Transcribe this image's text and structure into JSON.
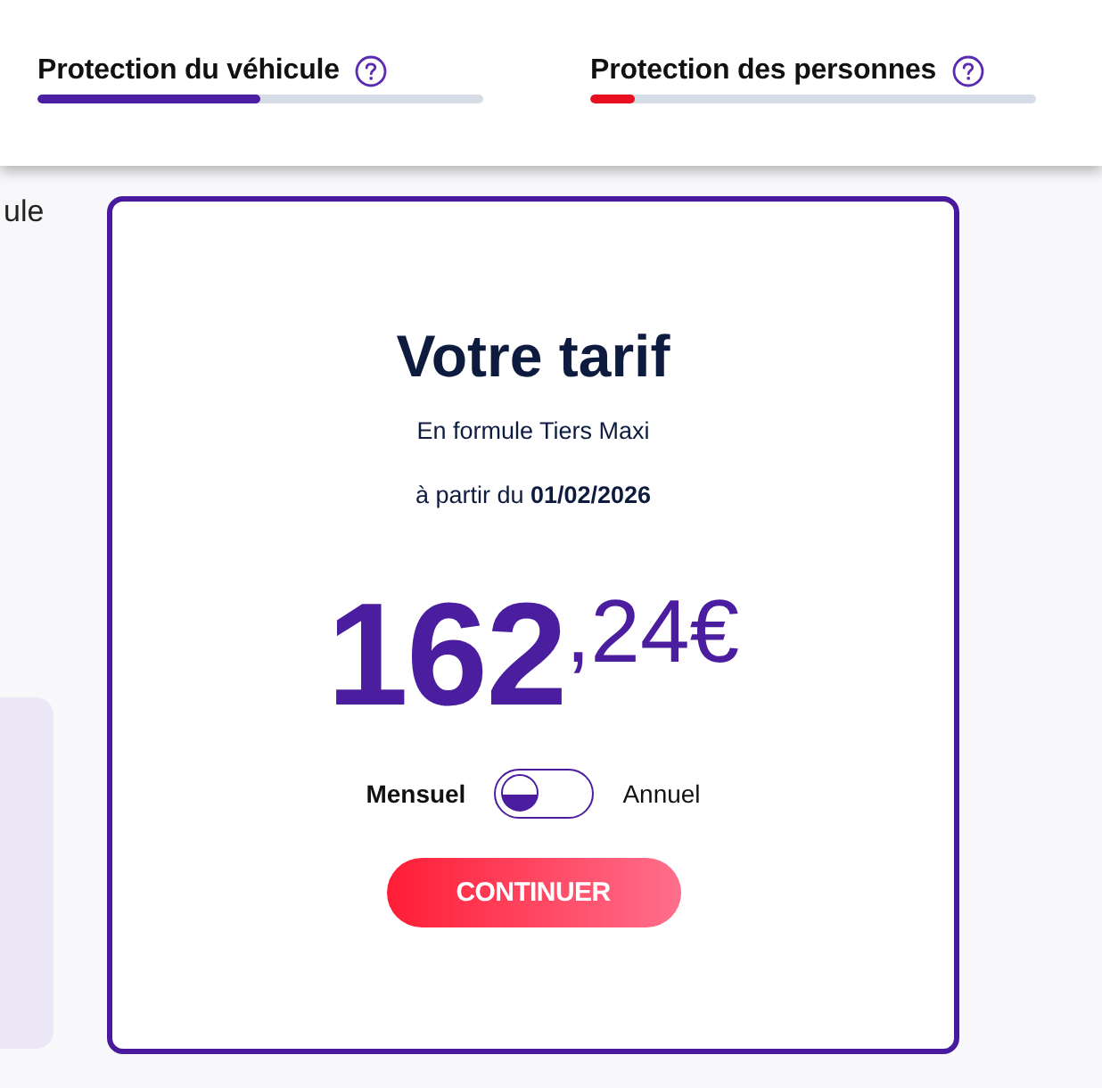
{
  "progress": [
    {
      "label": "Protection du véhicule",
      "level": 0.5,
      "color": "#4b1fa3"
    },
    {
      "label": "Protection des personnes",
      "level": 0.1,
      "color": "#e8101f"
    }
  ],
  "side": {
    "cut_text": "ule"
  },
  "quote": {
    "title": "Votre tarif",
    "formula": "En formule Tiers Maxi",
    "start": "à partir du **01/02/2026**",
    "price": {
      "whole": "162",
      "decimals": ",24€"
    },
    "billing": [
      {
        "label": "Mensuel",
        "selected": true
      },
      {
        "label": "Annuel",
        "selected": false
      }
    ],
    "button": "CONTINUER"
  }
}
